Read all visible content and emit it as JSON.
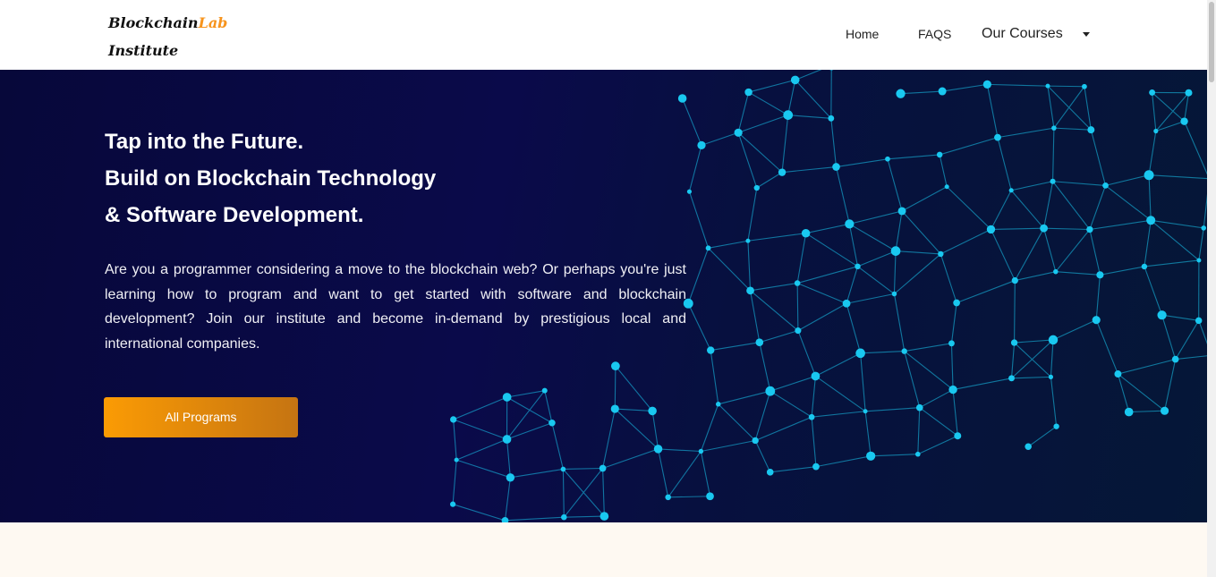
{
  "brand": {
    "line1_main": "Blockchain",
    "line1_accent": "Lab",
    "line2": "Institute"
  },
  "nav": {
    "home": "Home",
    "faqs": "FAQS",
    "courses": "Our Courses"
  },
  "hero": {
    "title_lines": [
      "Tap into the Future.",
      "Build on Blockchain Technology",
      "& Software Development."
    ],
    "description": "Are you a programmer considering a move to the blockchain web? Or perhaps you're just learning how to program and want to get started with software and blockchain development? Join our institute and become in-demand by prestigious local and international companies.",
    "cta_label": "All Programs"
  },
  "colors": {
    "accent": "#f7941d",
    "hero_bg": "#07083a",
    "network": "#19c8f0",
    "below_bg": "#fef9f2"
  },
  "icons": {
    "courses_dropdown": "caret-down-icon",
    "hero_graphic": "network-mesh-graphic"
  }
}
